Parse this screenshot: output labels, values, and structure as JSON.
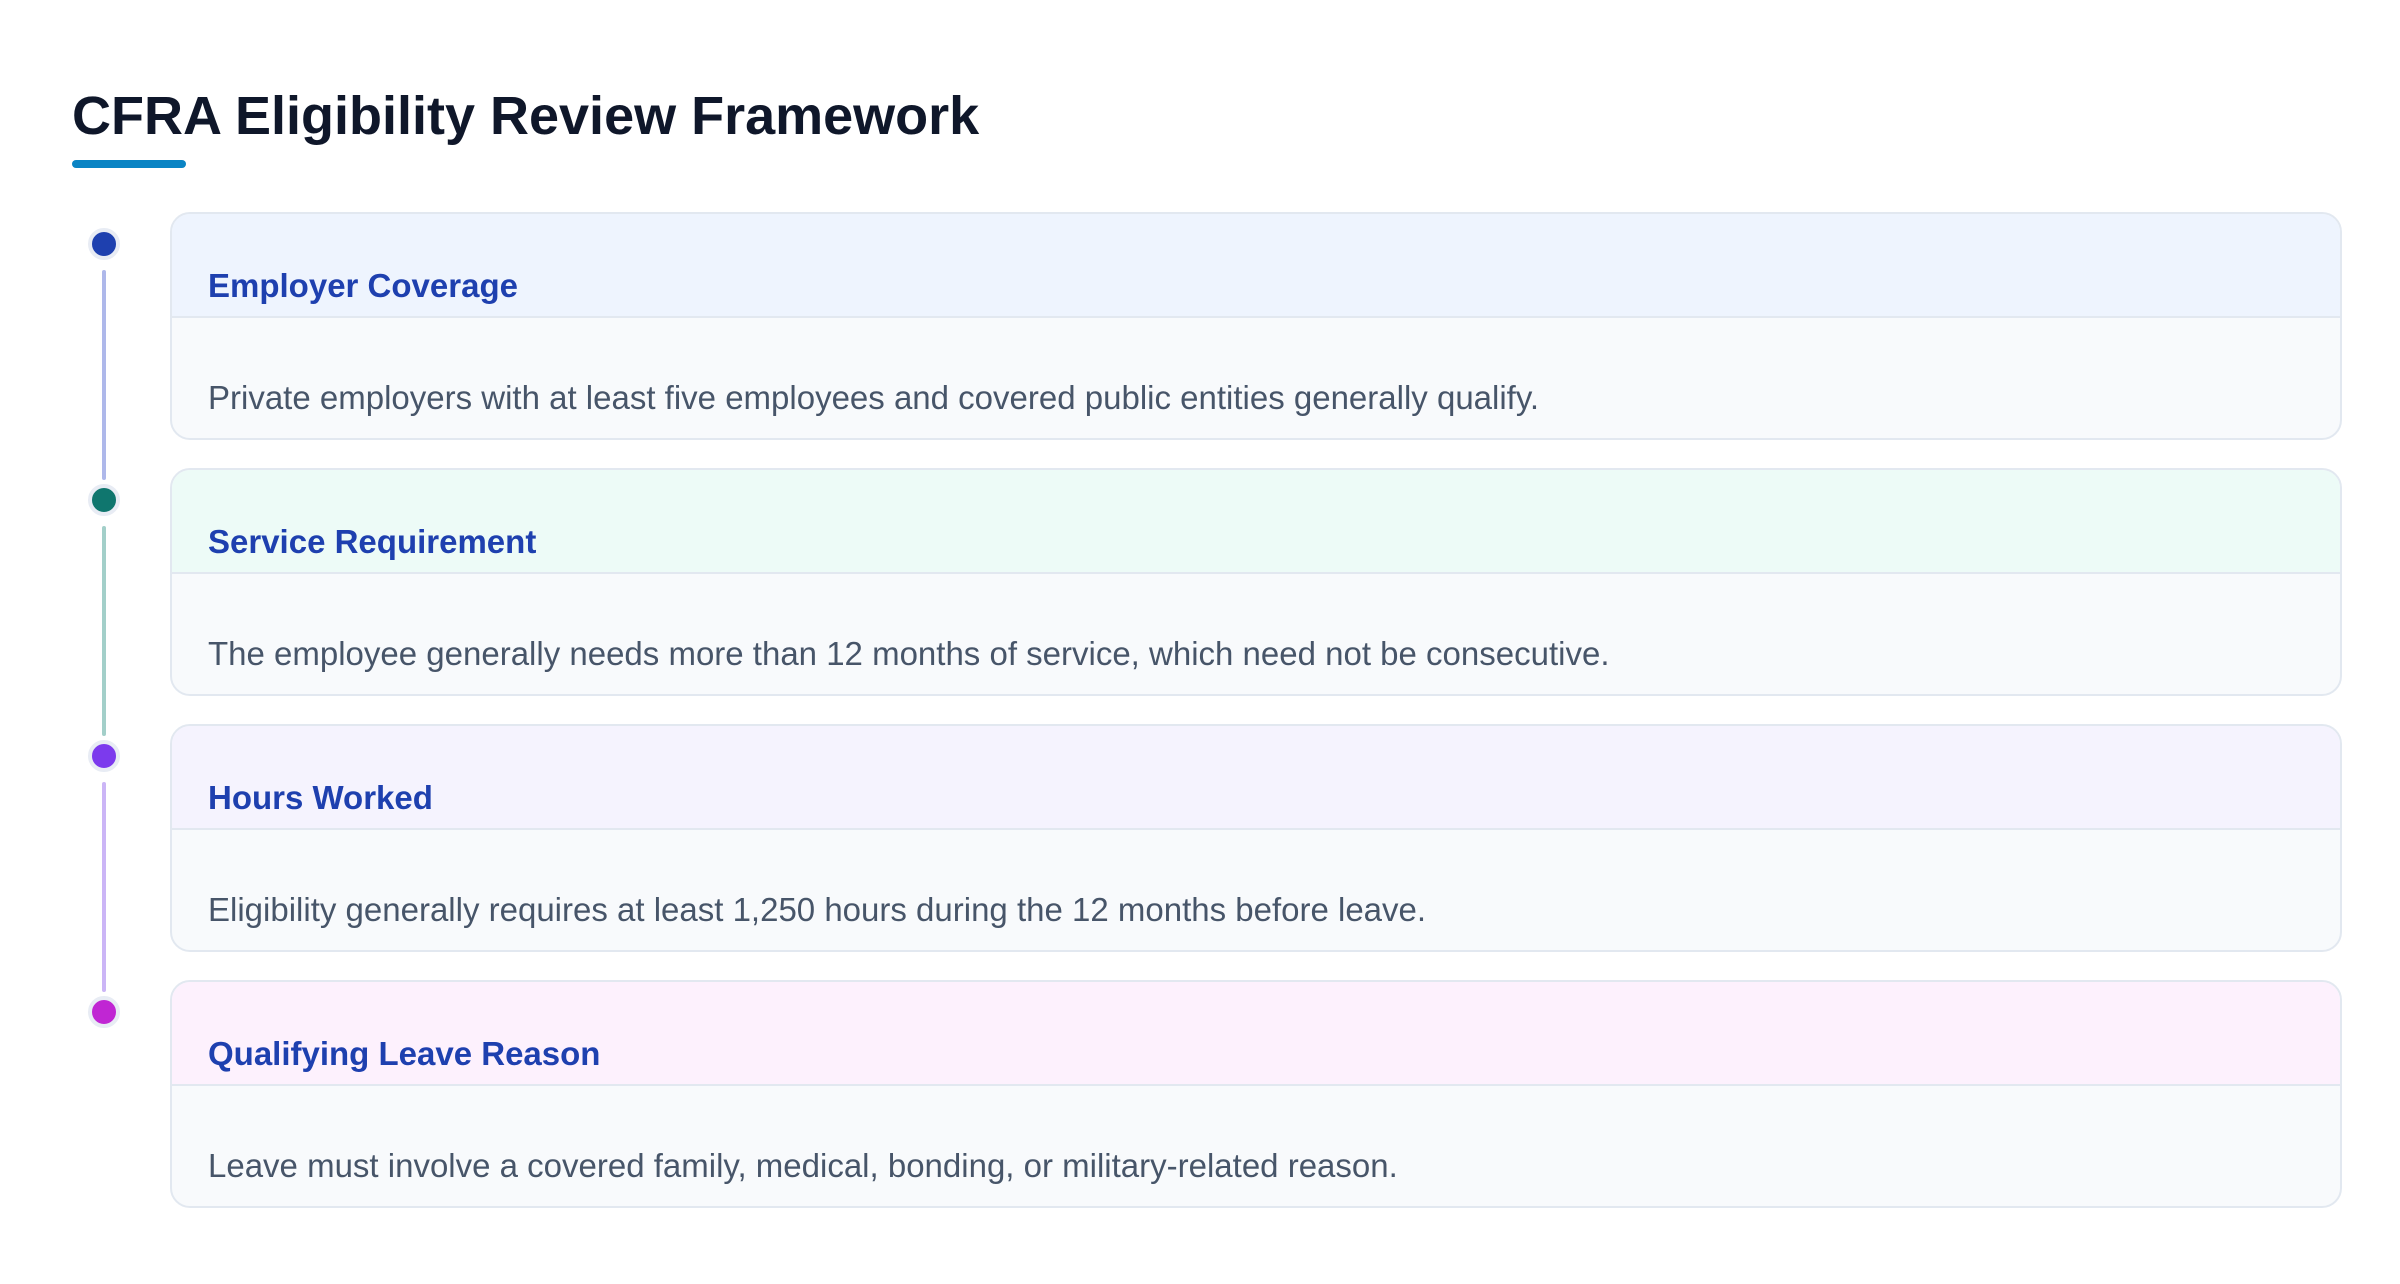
{
  "page": {
    "title": "CFRA Eligibility Review Framework",
    "accent_color": "#0a84c4"
  },
  "steps": [
    {
      "title": "Employer Coverage",
      "description": "Private employers with at least five employees and covered public entities generally qualify.",
      "node_color": "#1e40af",
      "line_color": "#aeb8ea",
      "header_color": "#eef4fe"
    },
    {
      "title": "Service Requirement",
      "description": "The employee generally needs more than 12 months of service, which need not be consecutive.",
      "node_color": "#0f766e",
      "line_color": "#a3cfc9",
      "header_color": "#edfbf7"
    },
    {
      "title": "Hours Worked",
      "description": "Eligibility generally requires at least 1,250 hours during the 12 months before leave.",
      "node_color": "#7c3aed",
      "line_color": "#cbb5f6",
      "header_color": "#f5f3fe"
    },
    {
      "title": "Qualifying Leave Reason",
      "description": "Leave must involve a covered family, medical, bonding, or military-related reason.",
      "node_color": "#c026d3",
      "line_color": "#ecb5f2",
      "header_color": "#fdf1fd"
    }
  ]
}
